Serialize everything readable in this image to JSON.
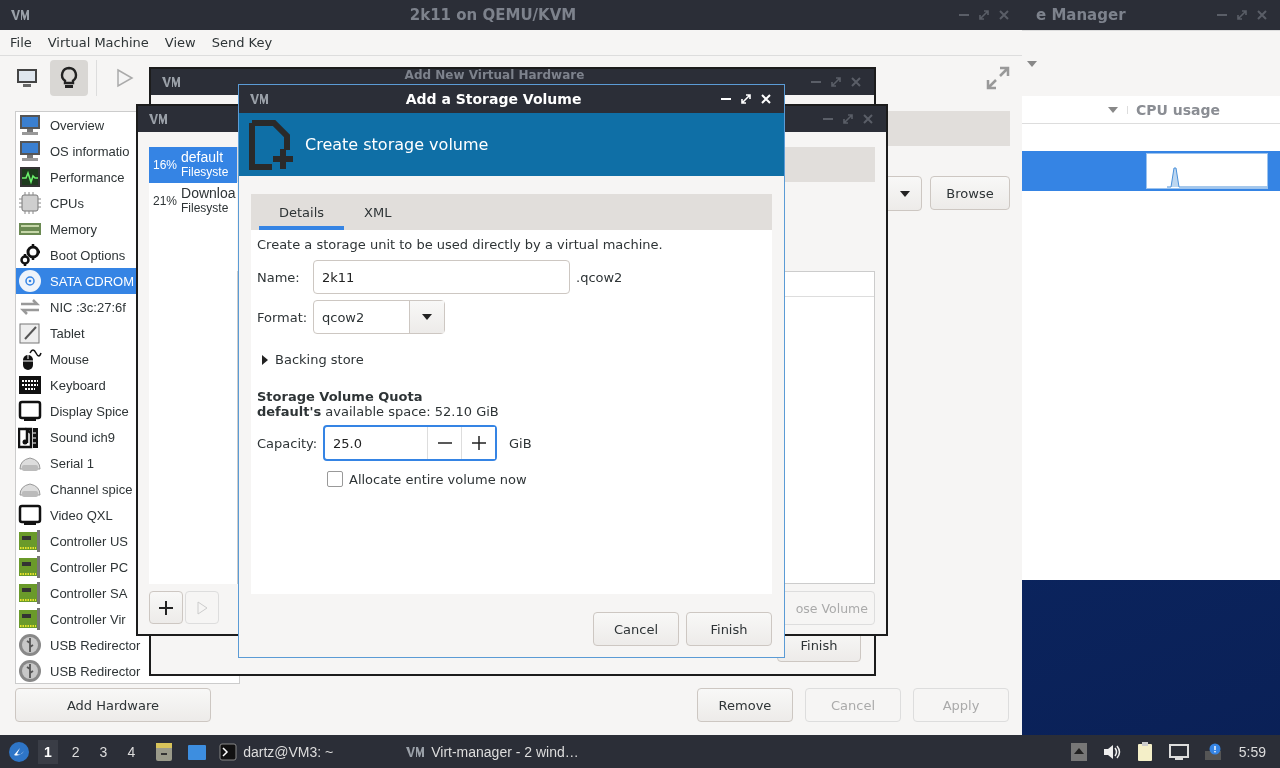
{
  "manager_window": {
    "title": "e Manager",
    "column_header": "CPU usage",
    "vm_rows": [
      {
        "selected": true
      }
    ]
  },
  "main_window": {
    "title": "2k11 on QEMU/KVM",
    "menu": [
      "File",
      "Virtual Machine",
      "View",
      "Send Key"
    ],
    "toolbar": [
      {
        "kind": "console",
        "selected": false
      },
      {
        "kind": "details",
        "selected": true
      },
      {
        "kind": "run",
        "selected": false
      }
    ],
    "hardware_list": [
      {
        "label": "Overview",
        "kind": "monitor",
        "selected": false
      },
      {
        "label": "OS informatio",
        "kind": "monitor",
        "selected": false
      },
      {
        "label": "Performance",
        "kind": "perf",
        "selected": false
      },
      {
        "label": "CPUs",
        "kind": "cpu",
        "selected": false
      },
      {
        "label": "Memory",
        "kind": "memory",
        "selected": false
      },
      {
        "label": "Boot Options",
        "kind": "gears",
        "selected": false
      },
      {
        "label": "SATA CDROM",
        "kind": "cdrom",
        "selected": true
      },
      {
        "label": "NIC :3c:27:6f",
        "kind": "nic",
        "selected": false
      },
      {
        "label": "Tablet",
        "kind": "tablet",
        "selected": false
      },
      {
        "label": "Mouse",
        "kind": "mouse",
        "selected": false
      },
      {
        "label": "Keyboard",
        "kind": "keyboard",
        "selected": false
      },
      {
        "label": "Display Spice",
        "kind": "display",
        "selected": false
      },
      {
        "label": "Sound ich9",
        "kind": "sound",
        "selected": false
      },
      {
        "label": "Serial 1",
        "kind": "serial",
        "selected": false
      },
      {
        "label": "Channel spice",
        "kind": "serial",
        "selected": false
      },
      {
        "label": "Video QXL",
        "kind": "display",
        "selected": false
      },
      {
        "label": "Controller US",
        "kind": "card",
        "selected": false
      },
      {
        "label": "Controller PC",
        "kind": "card",
        "selected": false
      },
      {
        "label": "Controller SA",
        "kind": "card",
        "selected": false
      },
      {
        "label": "Controller Vir",
        "kind": "card",
        "selected": false
      },
      {
        "label": "USB Redirector",
        "kind": "usb",
        "selected": false
      },
      {
        "label": "USB Redirector",
        "kind": "usb",
        "selected": false
      }
    ],
    "browse_button": "Browse",
    "add_hardware_button": "Add Hardware",
    "buttons": [
      {
        "label": "Remove",
        "disabled": false
      },
      {
        "label": "Cancel",
        "disabled": true
      },
      {
        "label": "Apply",
        "disabled": true
      }
    ]
  },
  "hardware_dialog": {
    "title": "Add New Virtual Hardware",
    "finish_button": "Finish"
  },
  "volume_dialog": {
    "pools": [
      {
        "usage": "16%",
        "name": "default",
        "type": "Filesyste",
        "selected": true
      },
      {
        "usage": "21%",
        "name": "Downloa",
        "type": "Filesyste",
        "selected": false
      }
    ],
    "pool_buttons": [
      {
        "kind": "add",
        "disabled": false
      },
      {
        "kind": "start",
        "disabled": true
      }
    ],
    "choose_button": "ose Volume"
  },
  "storage_dialog": {
    "title": "Add a Storage Volume",
    "header": "Create storage volume",
    "tabs": [
      {
        "label": "Details",
        "selected": true
      },
      {
        "label": "XML",
        "selected": false
      }
    ],
    "description": "Create a storage unit to be used directly by a virtual machine.",
    "name_label": "Name:",
    "name_value": "2k11",
    "name_suffix": ".qcow2",
    "format_label": "Format:",
    "format_value": "qcow2",
    "backing_store": {
      "label": "Backing store",
      "expanded": false
    },
    "quota_title": "Storage Volume Quota",
    "available": "**default's** available space: 52.10 GiB",
    "capacity_label": "Capacity:",
    "capacity_value": "25.0",
    "capacity_unit": "GiB",
    "allocate": {
      "label": "Allocate entire volume now",
      "checked": false
    },
    "buttons": [
      "Cancel",
      "Finish"
    ]
  },
  "taskbar": {
    "workspaces": [
      {
        "label": "1",
        "selected": true
      },
      {
        "label": "2",
        "selected": false
      },
      {
        "label": "3",
        "selected": false
      },
      {
        "label": "4",
        "selected": false
      }
    ],
    "tasks": [
      {
        "label": "dartz@VM3: ~",
        "kind": "terminal"
      },
      {
        "label": "Virt-manager - 2 wind…",
        "kind": "virt"
      }
    ],
    "clock": "5:59"
  }
}
